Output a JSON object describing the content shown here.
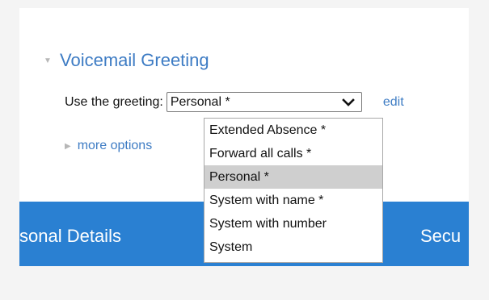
{
  "voicemail_section": {
    "title": "Voicemail Greeting",
    "greeting_label": "Use the greeting:",
    "selected_greeting": "Personal *",
    "edit_label": "edit",
    "more_options_label": "more options"
  },
  "greeting_options": [
    {
      "label": "Extended Absence *",
      "selected": false
    },
    {
      "label": "Forward all calls *",
      "selected": false
    },
    {
      "label": "Personal *",
      "selected": true
    },
    {
      "label": "System with name *",
      "selected": false
    },
    {
      "label": "System with number",
      "selected": false
    },
    {
      "label": "System",
      "selected": false
    }
  ],
  "tabs": {
    "personal_details": "sonal Details",
    "security": "Secu"
  },
  "colors": {
    "link_blue": "#3e7cc4",
    "tab_bar_blue": "#2a80d2",
    "selected_option_gray": "#cfcfcf"
  }
}
